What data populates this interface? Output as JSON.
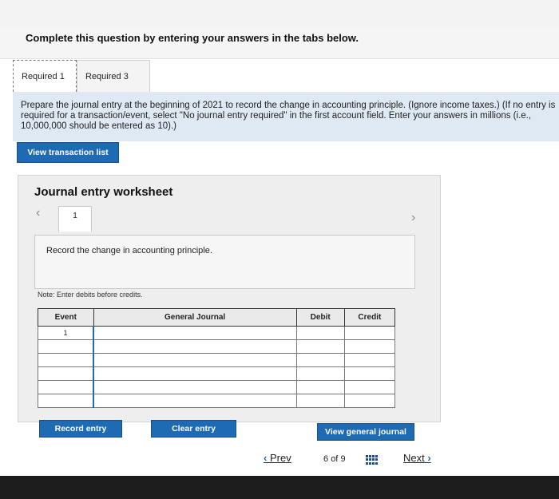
{
  "header": {
    "instruction": "Complete this question by entering your answers in the tabs below."
  },
  "tabs": [
    {
      "label": "Required 1"
    },
    {
      "label": "Required 3"
    }
  ],
  "prompt": "Prepare the journal entry at the beginning of 2021 to record the change in accounting principle. (Ignore income taxes.) (If no entry is required for a transaction/event, select \"No journal entry required\" in the first account field. Enter your answers in millions (i.e., 10,000,000 should be entered as 10).)",
  "buttons": {
    "view_transaction_list": "View transaction list",
    "record_entry": "Record entry",
    "clear_entry": "Clear entry",
    "view_general_journal": "View general journal"
  },
  "worksheet": {
    "title": "Journal entry worksheet",
    "current_tab": "1",
    "record_text": "Record the change in accounting principle.",
    "note": "Note: Enter debits before credits."
  },
  "journal": {
    "headers": {
      "event": "Event",
      "general_journal": "General Journal",
      "debit": "Debit",
      "credit": "Credit"
    },
    "rows": [
      {
        "event": "1",
        "account": "",
        "debit": "",
        "credit": ""
      },
      {
        "event": "",
        "account": "",
        "debit": "",
        "credit": ""
      },
      {
        "event": "",
        "account": "",
        "debit": "",
        "credit": ""
      },
      {
        "event": "",
        "account": "",
        "debit": "",
        "credit": ""
      },
      {
        "event": "",
        "account": "",
        "debit": "",
        "credit": ""
      },
      {
        "event": "",
        "account": "",
        "debit": "",
        "credit": ""
      }
    ]
  },
  "pagination": {
    "prev": "Prev",
    "current": "6",
    "of_label": "of",
    "total": "9",
    "next": "Next"
  },
  "icons": {
    "prev": "chevron-left-icon",
    "next": "chevron-right-icon",
    "grid": "grid-icon"
  },
  "colors": {
    "accent": "#1f6bb3",
    "instruction_bg": "#dfe9f3"
  }
}
